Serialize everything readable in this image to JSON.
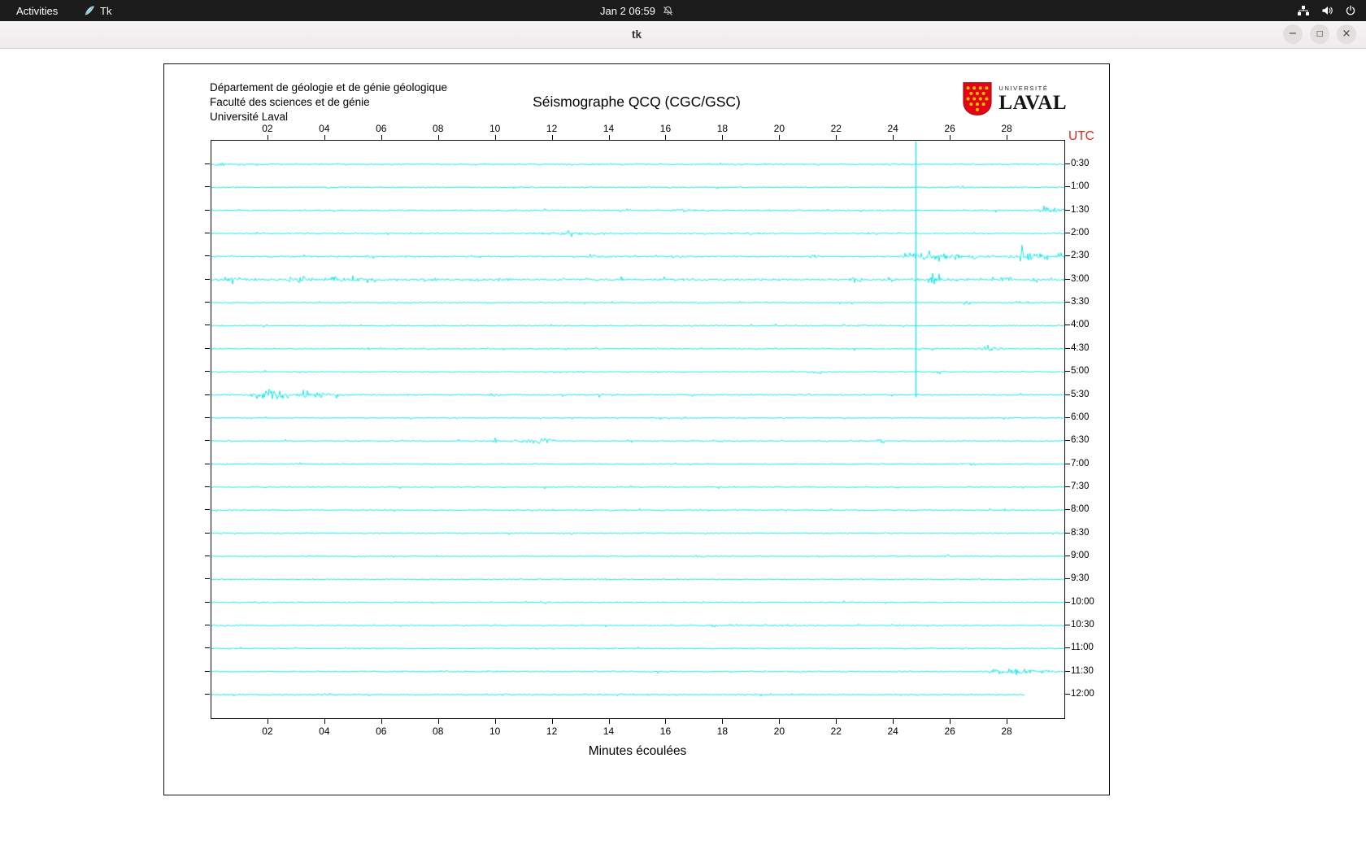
{
  "desktop": {
    "top_bar": {
      "activities_label": "Activities",
      "app_name": "Tk",
      "clock": "Jan 2 06:59",
      "icons": [
        "tk-feather-icon",
        "notifications-muted-icon",
        "network-icon",
        "volume-icon",
        "power-icon"
      ]
    },
    "window": {
      "title": "tk",
      "controls": {
        "minimize": "−",
        "maximize": "□",
        "close": "×"
      }
    }
  },
  "seismograph": {
    "header_lines": [
      "Département de géologie et de génie géologique",
      "Faculté des sciences et de génie",
      "Université Laval"
    ],
    "logo": {
      "small_text": "UNIVERSITÉ",
      "large_text": "LAVAL",
      "shield_color": "#e30513",
      "dot_color": "#f2c400"
    }
  },
  "chart_data": {
    "type": "line",
    "title": "Séismographe QCQ (CGC/GSC)",
    "xlabel": "Minutes écoulées",
    "utc_axis_label": "UTC",
    "utc_label_color": "#e8251a",
    "trace_color": "#00e6e6",
    "x_ticks": [
      "02",
      "04",
      "06",
      "08",
      "10",
      "12",
      "14",
      "16",
      "18",
      "20",
      "22",
      "24",
      "26",
      "28"
    ],
    "x_range": [
      0,
      30
    ],
    "vertical_line": {
      "minute": 24.78,
      "to_row": 10
    },
    "rows": [
      {
        "label": "0:30",
        "base": 1.1,
        "events": [
          [
            0.4,
            0.5,
            1.5
          ]
        ]
      },
      {
        "label": "1:00",
        "base": 1.1,
        "events": [
          [
            26.4,
            0.25,
            2.5
          ]
        ]
      },
      {
        "label": "1:30",
        "base": 1.1,
        "events": [
          [
            16.6,
            0.3,
            2
          ],
          [
            29.6,
            0.5,
            4
          ]
        ]
      },
      {
        "label": "2:00",
        "base": 1.2,
        "events": [
          [
            12.3,
            0.7,
            2
          ],
          [
            13.2,
            0.3,
            1.5
          ]
        ]
      },
      {
        "label": "2:30",
        "base": 1.2,
        "events": [
          [
            5.6,
            0.15,
            2.5
          ],
          [
            13.4,
            0.1,
            5
          ],
          [
            16.2,
            0.1,
            3
          ],
          [
            21.2,
            0.1,
            2.5
          ],
          [
            24.9,
            0.4,
            8
          ],
          [
            25.7,
            0.25,
            7
          ],
          [
            26.2,
            0.15,
            6
          ],
          [
            26.8,
            0.12,
            5
          ],
          [
            27.4,
            0.1,
            4
          ],
          [
            28.6,
            0.3,
            11
          ],
          [
            29.2,
            0.15,
            5
          ],
          [
            29.9,
            0.25,
            7
          ]
        ]
      },
      {
        "label": "3:00",
        "base": 1.6,
        "events": [
          [
            0.6,
            0.25,
            3.5
          ],
          [
            3.1,
            0.35,
            3.5
          ],
          [
            4.4,
            0.2,
            2.5
          ],
          [
            5,
            4.5,
            0.9
          ],
          [
            5.0,
            0.15,
            3.5
          ],
          [
            7.5,
            0.25,
            2.5
          ],
          [
            9.3,
            0.15,
            2.5
          ],
          [
            15,
            5,
            0.5
          ],
          [
            22.6,
            0.15,
            3.5
          ],
          [
            25.4,
            0.25,
            3.5
          ],
          [
            26.1,
            0.15,
            2.5
          ],
          [
            28.0,
            0.2,
            3.5
          ],
          [
            28.9,
            0.15,
            2.5
          ]
        ]
      },
      {
        "label": "3:30",
        "base": 1.1,
        "events": [
          [
            26.6,
            0.12,
            4.5
          ]
        ]
      },
      {
        "label": "4:00",
        "base": 1.0,
        "events": [
          [
            22.7,
            0.4,
            1.5
          ]
        ]
      },
      {
        "label": "4:30",
        "base": 1.1,
        "events": [
          [
            27.4,
            0.35,
            2.5
          ]
        ]
      },
      {
        "label": "5:00",
        "base": 1.0,
        "events": [
          [
            13.0,
            0.12,
            2.5
          ],
          [
            21.3,
            0.15,
            2
          ],
          [
            25.6,
            0.15,
            2
          ]
        ]
      },
      {
        "label": "5:30",
        "base": 1.2,
        "events": [
          [
            1.9,
            0.4,
            8
          ],
          [
            2.5,
            0.25,
            6
          ],
          [
            3.3,
            0.18,
            7
          ],
          [
            3.8,
            0.2,
            5
          ],
          [
            4.3,
            0.25,
            2.5
          ],
          [
            9.9,
            0.12,
            2.5
          ],
          [
            13.7,
            0.12,
            2.5
          ]
        ]
      },
      {
        "label": "6:00",
        "base": 0.9,
        "events": []
      },
      {
        "label": "6:30",
        "base": 1.0,
        "events": [
          [
            10.0,
            0.06,
            13
          ],
          [
            11.1,
            0.45,
            2.5
          ],
          [
            11.7,
            0.35,
            3
          ],
          [
            17.9,
            0.3,
            1.5
          ],
          [
            23.5,
            0.08,
            7
          ]
        ]
      },
      {
        "label": "7:00",
        "base": 0.9,
        "events": [
          [
            26.7,
            0.25,
            1.5
          ]
        ]
      },
      {
        "label": "7:30",
        "base": 1.0,
        "events": []
      },
      {
        "label": "8:00",
        "base": 1.1,
        "events": []
      },
      {
        "label": "8:30",
        "base": 0.9,
        "events": []
      },
      {
        "label": "9:00",
        "base": 0.9,
        "events": [
          [
            25.9,
            0.15,
            1.5
          ]
        ]
      },
      {
        "label": "9:30",
        "base": 0.9,
        "events": []
      },
      {
        "label": "10:00",
        "base": 1.0,
        "events": []
      },
      {
        "label": "10:30",
        "base": 1.1,
        "events": [
          [
            19.3,
            1.5,
            1.0
          ]
        ]
      },
      {
        "label": "11:00",
        "base": 0.9,
        "events": []
      },
      {
        "label": "11:30",
        "base": 1.1,
        "events": [
          [
            27.6,
            0.4,
            3.5
          ],
          [
            28.5,
            0.4,
            3.5
          ],
          [
            29.3,
            0.25,
            2.5
          ]
        ]
      },
      {
        "label": "12:00",
        "base": 1.3,
        "events": [],
        "end": 28.6
      }
    ]
  }
}
